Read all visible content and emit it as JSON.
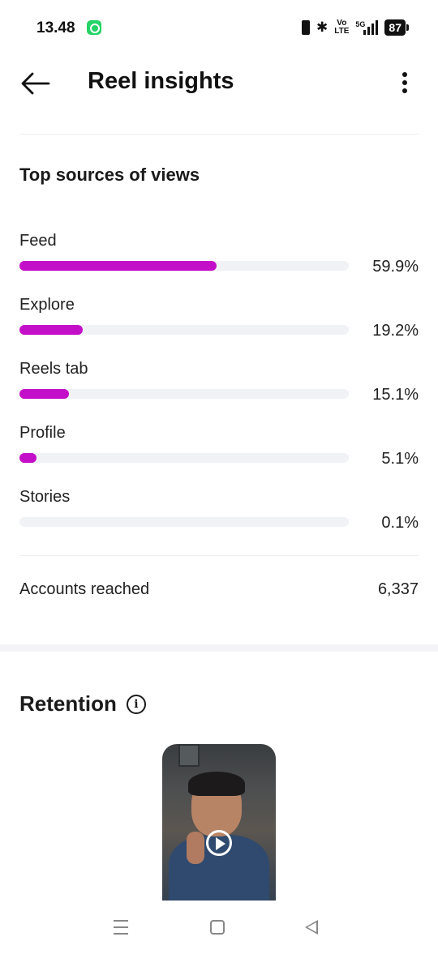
{
  "status_bar": {
    "time": "13.48",
    "volte_top": "Vo",
    "volte_bottom": "LTE",
    "network": "5G",
    "battery": "87"
  },
  "header": {
    "title": "Reel insights"
  },
  "top_sources": {
    "title": "Top sources of views",
    "items": [
      {
        "label": "Feed",
        "percent_text": "59.9%",
        "value": 59.9
      },
      {
        "label": "Explore",
        "percent_text": "19.2%",
        "value": 19.2
      },
      {
        "label": "Reels tab",
        "percent_text": "15.1%",
        "value": 15.1
      },
      {
        "label": "Profile",
        "percent_text": "5.1%",
        "value": 5.1
      },
      {
        "label": "Stories",
        "percent_text": "0.1%",
        "value": 0.1
      }
    ],
    "bar_color": "#c30fc8"
  },
  "accounts_reached": {
    "label": "Accounts reached",
    "value": "6,337"
  },
  "retention": {
    "title": "Retention",
    "info_symbol": "i"
  },
  "icons": {
    "back": "arrow-left-icon",
    "more": "more-vertical-icon",
    "info": "info-icon",
    "play": "play-icon"
  }
}
